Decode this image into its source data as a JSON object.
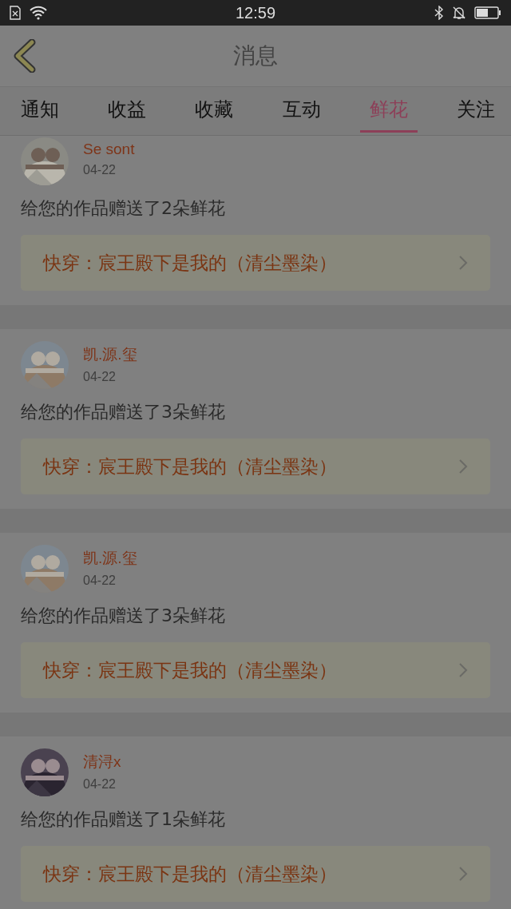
{
  "status_bar": {
    "time": "12:59"
  },
  "header": {
    "title": "消息"
  },
  "tabs": [
    {
      "label": "通知",
      "selected": false
    },
    {
      "label": "收益",
      "selected": false
    },
    {
      "label": "收藏",
      "selected": false
    },
    {
      "label": "互动",
      "selected": false
    },
    {
      "label": "鲜花",
      "selected": true
    },
    {
      "label": "关注",
      "selected": false
    }
  ],
  "messages": [
    {
      "name": "Se sont",
      "date": "04-22",
      "text": "给您的作品赠送了2朵鲜花",
      "book": "快穿：宸王殿下是我的（清尘墨染）"
    },
    {
      "name": "凯.源.玺",
      "date": "04-22",
      "text": "给您的作品赠送了3朵鲜花",
      "book": "快穿：宸王殿下是我的（清尘墨染）"
    },
    {
      "name": "凯.源.玺",
      "date": "04-22",
      "text": "给您的作品赠送了3朵鲜花",
      "book": "快穿：宸王殿下是我的（清尘墨染）"
    },
    {
      "name": "清浔x",
      "date": "04-22",
      "text": "给您的作品赠送了1朵鲜花",
      "book": "快穿：宸王殿下是我的（清尘墨染）"
    }
  ]
}
